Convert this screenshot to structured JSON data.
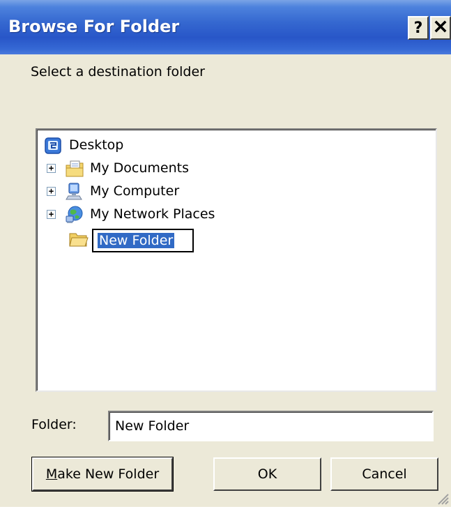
{
  "window": {
    "title": "Browse For Folder",
    "help_button": "?",
    "close_button": "✕"
  },
  "prompt": "Select a destination folder",
  "tree": {
    "items": [
      {
        "label": "Desktop",
        "icon": "desktop-icon",
        "expandable": false
      },
      {
        "label": "My Documents",
        "icon": "my-documents-icon",
        "expandable": true
      },
      {
        "label": "My Computer",
        "icon": "my-computer-icon",
        "expandable": true
      },
      {
        "label": "My Network Places",
        "icon": "network-places-icon",
        "expandable": true
      },
      {
        "label": "New Folder",
        "icon": "folder-open-icon",
        "expandable": false,
        "selected": true,
        "editing": true
      }
    ],
    "expander_symbol": "+"
  },
  "folder": {
    "label": "Folder:",
    "value": "New Folder"
  },
  "buttons": {
    "make_new_folder": "Make New Folder",
    "make_new_folder_accel": "M",
    "make_new_folder_rest": "ake New Folder",
    "ok": "OK",
    "cancel": "Cancel"
  },
  "colors": {
    "titlebar": "#2856c8",
    "selection": "#316ac5",
    "dialog_bg": "#ece9d8"
  }
}
